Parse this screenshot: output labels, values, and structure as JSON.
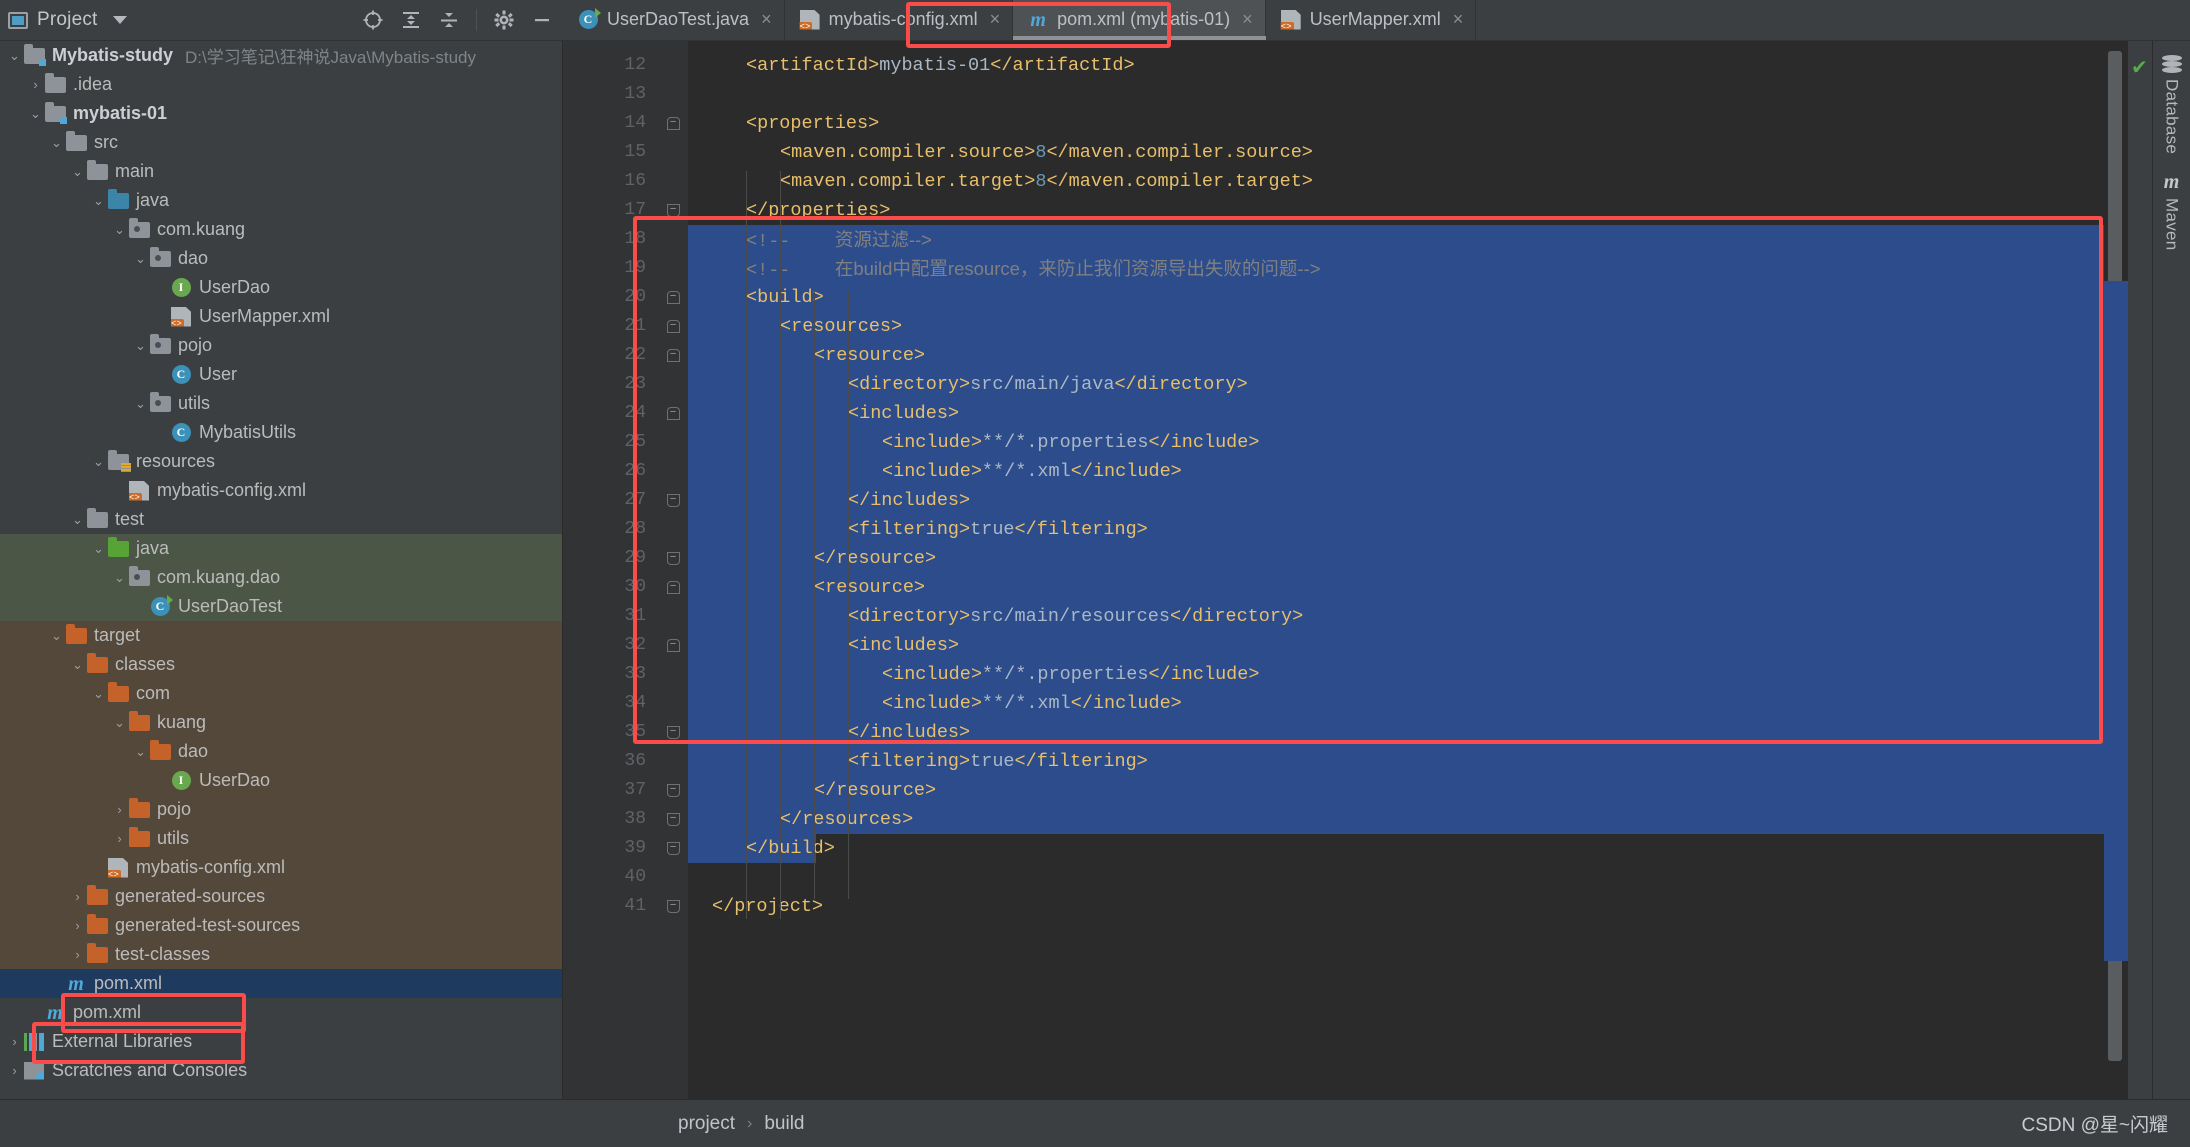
{
  "project_panel": {
    "title": "Project",
    "caret_icon": "chevron-down-icon",
    "tools": [
      {
        "name": "locate-icon",
        "glyph": "⊕"
      },
      {
        "name": "expand-all-icon",
        "glyph": "↧"
      },
      {
        "name": "collapse-all-icon",
        "glyph": "↥"
      },
      {
        "name": "gear-icon",
        "glyph": "⚙"
      },
      {
        "name": "hide-icon",
        "glyph": "—"
      }
    ],
    "tree": [
      {
        "depth": 0,
        "arrow": "⌄",
        "label": "Mybatis-study",
        "path": "D:\\学习笔记\\狂神说Java\\Mybatis-study",
        "icon": "project-folder-icon",
        "bold": true,
        "hl": ""
      },
      {
        "depth": 1,
        "arrow": "›",
        "label": ".idea",
        "path": "",
        "icon": "folder-icon",
        "bold": false,
        "hl": ""
      },
      {
        "depth": 1,
        "arrow": "⌄",
        "label": "mybatis-01",
        "path": "",
        "icon": "module-folder-icon",
        "bold": true,
        "hl": ""
      },
      {
        "depth": 2,
        "arrow": "⌄",
        "label": "src",
        "path": "",
        "icon": "folder-icon",
        "bold": false,
        "hl": ""
      },
      {
        "depth": 3,
        "arrow": "⌄",
        "label": "main",
        "path": "",
        "icon": "folder-icon",
        "bold": false,
        "hl": ""
      },
      {
        "depth": 4,
        "arrow": "⌄",
        "label": "java",
        "path": "",
        "icon": "source-folder-icon",
        "bold": false,
        "hl": ""
      },
      {
        "depth": 5,
        "arrow": "⌄",
        "label": "com.kuang",
        "path": "",
        "icon": "package-icon",
        "bold": false,
        "hl": ""
      },
      {
        "depth": 6,
        "arrow": "⌄",
        "label": "dao",
        "path": "",
        "icon": "package-icon",
        "bold": false,
        "hl": ""
      },
      {
        "depth": 7,
        "arrow": "",
        "label": "UserDao",
        "path": "",
        "icon": "interface-icon",
        "bold": false,
        "hl": ""
      },
      {
        "depth": 7,
        "arrow": "",
        "label": "UserMapper.xml",
        "path": "",
        "icon": "xml-file-icon",
        "bold": false,
        "hl": ""
      },
      {
        "depth": 6,
        "arrow": "⌄",
        "label": "pojo",
        "path": "",
        "icon": "package-icon",
        "bold": false,
        "hl": ""
      },
      {
        "depth": 7,
        "arrow": "",
        "label": "User",
        "path": "",
        "icon": "class-icon",
        "bold": false,
        "hl": ""
      },
      {
        "depth": 6,
        "arrow": "⌄",
        "label": "utils",
        "path": "",
        "icon": "package-icon",
        "bold": false,
        "hl": ""
      },
      {
        "depth": 7,
        "arrow": "",
        "label": "MybatisUtils",
        "path": "",
        "icon": "class-icon",
        "bold": false,
        "hl": ""
      },
      {
        "depth": 4,
        "arrow": "⌄",
        "label": "resources",
        "path": "",
        "icon": "resources-folder-icon",
        "bold": false,
        "hl": ""
      },
      {
        "depth": 5,
        "arrow": "",
        "label": "mybatis-config.xml",
        "path": "",
        "icon": "xml-file-icon",
        "bold": false,
        "hl": ""
      },
      {
        "depth": 3,
        "arrow": "⌄",
        "label": "test",
        "path": "",
        "icon": "folder-icon",
        "bold": false,
        "hl": ""
      },
      {
        "depth": 4,
        "arrow": "⌄",
        "label": "java",
        "path": "",
        "icon": "test-source-folder-icon",
        "bold": false,
        "hl": "green"
      },
      {
        "depth": 5,
        "arrow": "⌄",
        "label": "com.kuang.dao",
        "path": "",
        "icon": "package-icon",
        "bold": false,
        "hl": "green"
      },
      {
        "depth": 6,
        "arrow": "",
        "label": "UserDaoTest",
        "path": "",
        "icon": "test-class-icon",
        "bold": false,
        "hl": "green"
      },
      {
        "depth": 2,
        "arrow": "⌄",
        "label": "target",
        "path": "",
        "icon": "target-folder-icon",
        "bold": false,
        "hl": "brown"
      },
      {
        "depth": 3,
        "arrow": "⌄",
        "label": "classes",
        "path": "",
        "icon": "target-folder-icon",
        "bold": false,
        "hl": "brown"
      },
      {
        "depth": 4,
        "arrow": "⌄",
        "label": "com",
        "path": "",
        "icon": "target-folder-icon",
        "bold": false,
        "hl": "brown"
      },
      {
        "depth": 5,
        "arrow": "⌄",
        "label": "kuang",
        "path": "",
        "icon": "target-folder-icon",
        "bold": false,
        "hl": "brown"
      },
      {
        "depth": 6,
        "arrow": "⌄",
        "label": "dao",
        "path": "",
        "icon": "target-folder-icon",
        "bold": false,
        "hl": "brown"
      },
      {
        "depth": 7,
        "arrow": "",
        "label": "UserDao",
        "path": "",
        "icon": "interface-icon",
        "bold": false,
        "hl": "brown"
      },
      {
        "depth": 5,
        "arrow": "›",
        "label": "pojo",
        "path": "",
        "icon": "target-folder-icon",
        "bold": false,
        "hl": "brown"
      },
      {
        "depth": 5,
        "arrow": "›",
        "label": "utils",
        "path": "",
        "icon": "target-folder-icon",
        "bold": false,
        "hl": "brown"
      },
      {
        "depth": 4,
        "arrow": "",
        "label": "mybatis-config.xml",
        "path": "",
        "icon": "xml-file-icon",
        "bold": false,
        "hl": "brown"
      },
      {
        "depth": 3,
        "arrow": "›",
        "label": "generated-sources",
        "path": "",
        "icon": "target-folder-icon",
        "bold": false,
        "hl": "brown"
      },
      {
        "depth": 3,
        "arrow": "›",
        "label": "generated-test-sources",
        "path": "",
        "icon": "target-folder-icon",
        "bold": false,
        "hl": "brown"
      },
      {
        "depth": 3,
        "arrow": "›",
        "label": "test-classes",
        "path": "",
        "icon": "target-folder-icon",
        "bold": false,
        "hl": "brown"
      },
      {
        "depth": 2,
        "arrow": "",
        "label": "pom.xml",
        "path": "",
        "icon": "maven-file-icon",
        "bold": false,
        "hl": "sel"
      },
      {
        "depth": 1,
        "arrow": "",
        "label": "pom.xml",
        "path": "",
        "icon": "maven-file-icon",
        "bold": false,
        "hl": ""
      },
      {
        "depth": 0,
        "arrow": "›",
        "label": "External Libraries",
        "path": "",
        "icon": "libraries-icon",
        "bold": false,
        "hl": ""
      },
      {
        "depth": 0,
        "arrow": "›",
        "label": "Scratches and Consoles",
        "path": "",
        "icon": "scratches-icon",
        "bold": false,
        "hl": ""
      }
    ]
  },
  "tabs": [
    {
      "label": "UserDaoTest.java",
      "icon": "test-class-icon",
      "active": false,
      "close": "×"
    },
    {
      "label": "mybatis-config.xml",
      "icon": "xml-file-icon",
      "active": false,
      "close": "×"
    },
    {
      "label": "pom.xml (mybatis-01)",
      "icon": "maven-file-icon",
      "active": true,
      "close": "×"
    },
    {
      "label": "UserMapper.xml",
      "icon": "xml-file-icon",
      "active": false,
      "close": "×"
    }
  ],
  "editor": {
    "first_line": 12,
    "lines": [
      {
        "n": 12,
        "fold": "",
        "indent": 1,
        "sel": false,
        "parts": [
          {
            "t": "tag",
            "v": "<artifactId>"
          },
          {
            "t": "txt",
            "v": "mybatis-01"
          },
          {
            "t": "tag",
            "v": "</artifactId>"
          }
        ]
      },
      {
        "n": 13,
        "fold": "",
        "indent": 0,
        "sel": false,
        "parts": []
      },
      {
        "n": 14,
        "fold": "open",
        "indent": 1,
        "sel": false,
        "parts": [
          {
            "t": "tag",
            "v": "<properties>"
          }
        ]
      },
      {
        "n": 15,
        "fold": "",
        "indent": 2,
        "sel": false,
        "parts": [
          {
            "t": "tag",
            "v": "<maven.compiler.source>"
          },
          {
            "t": "num",
            "v": "8"
          },
          {
            "t": "tag",
            "v": "</maven.compiler.source>"
          }
        ]
      },
      {
        "n": 16,
        "fold": "",
        "indent": 2,
        "sel": false,
        "parts": [
          {
            "t": "tag",
            "v": "<maven.compiler.target>"
          },
          {
            "t": "num",
            "v": "8"
          },
          {
            "t": "tag",
            "v": "</maven.compiler.target>"
          }
        ]
      },
      {
        "n": 17,
        "fold": "close",
        "indent": 1,
        "sel": false,
        "parts": [
          {
            "t": "tag",
            "v": "</properties>"
          }
        ]
      },
      {
        "n": 18,
        "fold": "",
        "indent": 1,
        "sel": true,
        "parts": [
          {
            "t": "cmt",
            "v": "<!--    "
          },
          {
            "t": "cmtcn",
            "v": "资源过滤-->"
          }
        ]
      },
      {
        "n": 19,
        "fold": "",
        "indent": 1,
        "sel": true,
        "parts": [
          {
            "t": "cmt",
            "v": "<!--    "
          },
          {
            "t": "cmtcn",
            "v": "在build中配置resource，来防止我们资源导出失败的问题-->"
          }
        ]
      },
      {
        "n": 20,
        "fold": "open",
        "indent": 1,
        "sel": true,
        "parts": [
          {
            "t": "tag",
            "v": "<build>"
          }
        ]
      },
      {
        "n": 21,
        "fold": "open",
        "indent": 2,
        "sel": true,
        "parts": [
          {
            "t": "tag",
            "v": "<resources>"
          }
        ]
      },
      {
        "n": 22,
        "fold": "open",
        "indent": 3,
        "sel": true,
        "parts": [
          {
            "t": "tag",
            "v": "<resource>"
          }
        ]
      },
      {
        "n": 23,
        "fold": "",
        "indent": 4,
        "sel": true,
        "parts": [
          {
            "t": "tag",
            "v": "<directory>"
          },
          {
            "t": "txt",
            "v": "src/main/java"
          },
          {
            "t": "tag",
            "v": "</directory>"
          }
        ]
      },
      {
        "n": 24,
        "fold": "open",
        "indent": 4,
        "sel": true,
        "parts": [
          {
            "t": "tag",
            "v": "<includes>"
          }
        ]
      },
      {
        "n": 25,
        "fold": "",
        "indent": 5,
        "sel": true,
        "parts": [
          {
            "t": "tag",
            "v": "<include>"
          },
          {
            "t": "txt",
            "v": "**/*.properties"
          },
          {
            "t": "tag",
            "v": "</include>"
          }
        ]
      },
      {
        "n": 26,
        "fold": "",
        "indent": 5,
        "sel": true,
        "parts": [
          {
            "t": "tag",
            "v": "<include>"
          },
          {
            "t": "txt",
            "v": "**/*.xml"
          },
          {
            "t": "tag",
            "v": "</include>"
          }
        ]
      },
      {
        "n": 27,
        "fold": "close",
        "indent": 4,
        "sel": true,
        "parts": [
          {
            "t": "tag",
            "v": "</includes>"
          }
        ]
      },
      {
        "n": 28,
        "fold": "",
        "indent": 4,
        "sel": true,
        "parts": [
          {
            "t": "tag",
            "v": "<filtering>"
          },
          {
            "t": "txt",
            "v": "true"
          },
          {
            "t": "tag",
            "v": "</filtering>"
          }
        ]
      },
      {
        "n": 29,
        "fold": "close",
        "indent": 3,
        "sel": true,
        "parts": [
          {
            "t": "tag",
            "v": "</resource>"
          }
        ]
      },
      {
        "n": 30,
        "fold": "open",
        "indent": 3,
        "sel": true,
        "parts": [
          {
            "t": "tag",
            "v": "<resource>"
          }
        ]
      },
      {
        "n": 31,
        "fold": "",
        "indent": 4,
        "sel": true,
        "parts": [
          {
            "t": "tag",
            "v": "<directory>"
          },
          {
            "t": "txt",
            "v": "src/main/resources"
          },
          {
            "t": "tag",
            "v": "</directory>"
          }
        ]
      },
      {
        "n": 32,
        "fold": "open",
        "indent": 4,
        "sel": true,
        "parts": [
          {
            "t": "tag",
            "v": "<includes>"
          }
        ]
      },
      {
        "n": 33,
        "fold": "",
        "indent": 5,
        "sel": true,
        "parts": [
          {
            "t": "tag",
            "v": "<include>"
          },
          {
            "t": "txt",
            "v": "**/*.properties"
          },
          {
            "t": "tag",
            "v": "</include>"
          }
        ]
      },
      {
        "n": 34,
        "fold": "",
        "indent": 5,
        "sel": true,
        "parts": [
          {
            "t": "tag",
            "v": "<include>"
          },
          {
            "t": "txt",
            "v": "**/*.xml"
          },
          {
            "t": "tag",
            "v": "</include>"
          }
        ]
      },
      {
        "n": 35,
        "fold": "close",
        "indent": 4,
        "sel": true,
        "parts": [
          {
            "t": "tag",
            "v": "</includes>"
          }
        ]
      },
      {
        "n": 36,
        "fold": "",
        "indent": 4,
        "sel": true,
        "parts": [
          {
            "t": "tag",
            "v": "<filtering>"
          },
          {
            "t": "txt",
            "v": "true"
          },
          {
            "t": "tag",
            "v": "</filtering>"
          }
        ]
      },
      {
        "n": 37,
        "fold": "close",
        "indent": 3,
        "sel": true,
        "parts": [
          {
            "t": "tag",
            "v": "</resource>"
          }
        ]
      },
      {
        "n": 38,
        "fold": "close",
        "indent": 2,
        "sel": true,
        "parts": [
          {
            "t": "tag",
            "v": "</resources>"
          }
        ]
      },
      {
        "n": 39,
        "fold": "close",
        "indent": 1,
        "sel": "part",
        "parts": [
          {
            "t": "tag",
            "v": "</build>"
          }
        ]
      },
      {
        "n": 40,
        "fold": "",
        "indent": 0,
        "sel": false,
        "parts": []
      },
      {
        "n": 41,
        "fold": "close",
        "indent": 0,
        "sel": false,
        "parts": [
          {
            "t": "tag",
            "v": "</project>"
          }
        ]
      }
    ]
  },
  "right_sidebar": [
    {
      "label": "Database",
      "icon": "database-icon"
    },
    {
      "label": "Maven",
      "icon": "maven-icon"
    }
  ],
  "inspection": {
    "status_icon": "check-ok-icon",
    "glyph": "✔"
  },
  "status_bar": {
    "breadcrumb": [
      "project",
      "build"
    ],
    "separator": "›",
    "watermark": "CSDN @星~闪耀"
  },
  "annotations": {
    "color": "#fb4c4c",
    "boxes": [
      "tab-pom-xml-box",
      "code-build-block-box",
      "pom-xml-module-box",
      "pom-xml-root-box"
    ]
  }
}
